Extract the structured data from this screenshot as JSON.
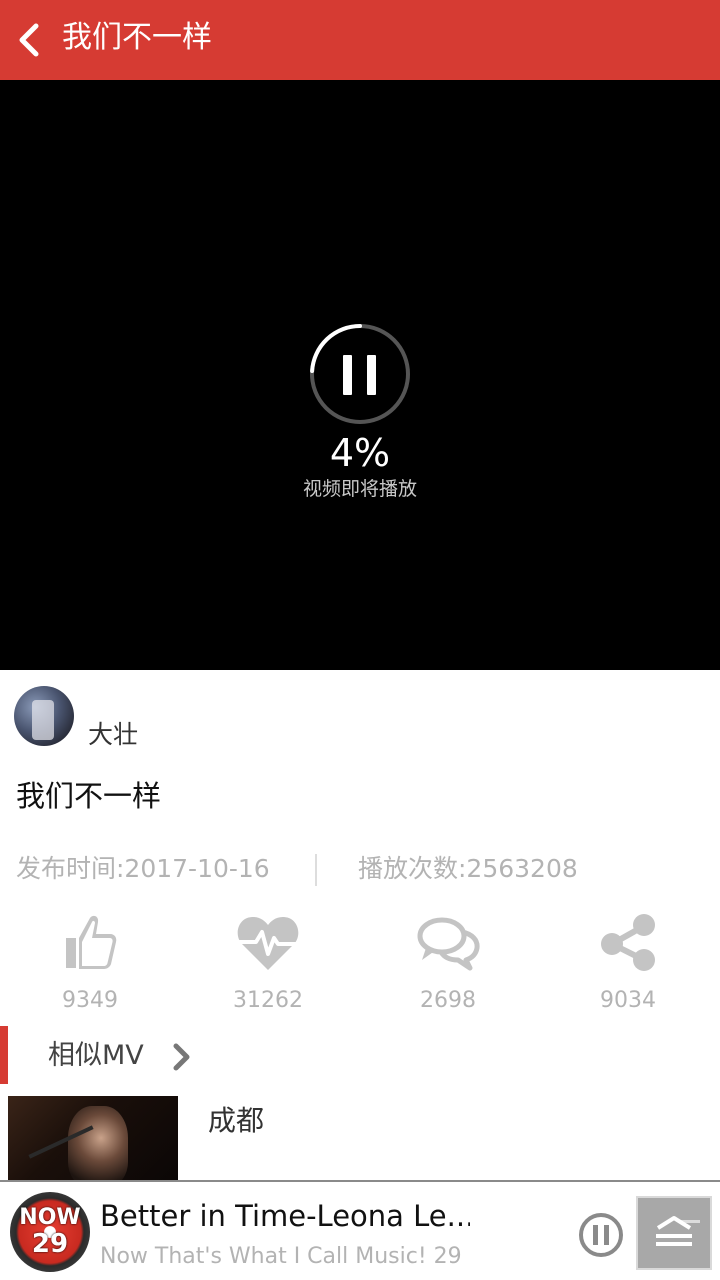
{
  "header": {
    "title": "我们不一样",
    "back_icon": "chevron-left-icon",
    "background_color": "#d63b33"
  },
  "video": {
    "progress_percent": 4,
    "percent_text": "4%",
    "status_text": "视频即将播放",
    "state_icon": "pause-icon"
  },
  "author": {
    "name": "大壮"
  },
  "song": {
    "title": "我们不一样",
    "publish_date": "发布时间:2017-10-16",
    "play_count": "播放次数:2563208"
  },
  "actions": [
    {
      "icon": "thumbs-up-icon",
      "count": "9349"
    },
    {
      "icon": "heartbeat-icon",
      "count": "31262"
    },
    {
      "icon": "comment-icon",
      "count": "2698"
    },
    {
      "icon": "share-icon",
      "count": "9034"
    }
  ],
  "similar": {
    "title": "相似MV",
    "items": [
      {
        "name": "成都"
      }
    ]
  },
  "player": {
    "song": "Better in Time-Leona Le...",
    "album": "Now That's What I Call Music! 29",
    "album_art_text": "NOW",
    "album_art_number": "29",
    "state_icon": "pause-icon",
    "playlist_icon": "playlist-icon"
  }
}
